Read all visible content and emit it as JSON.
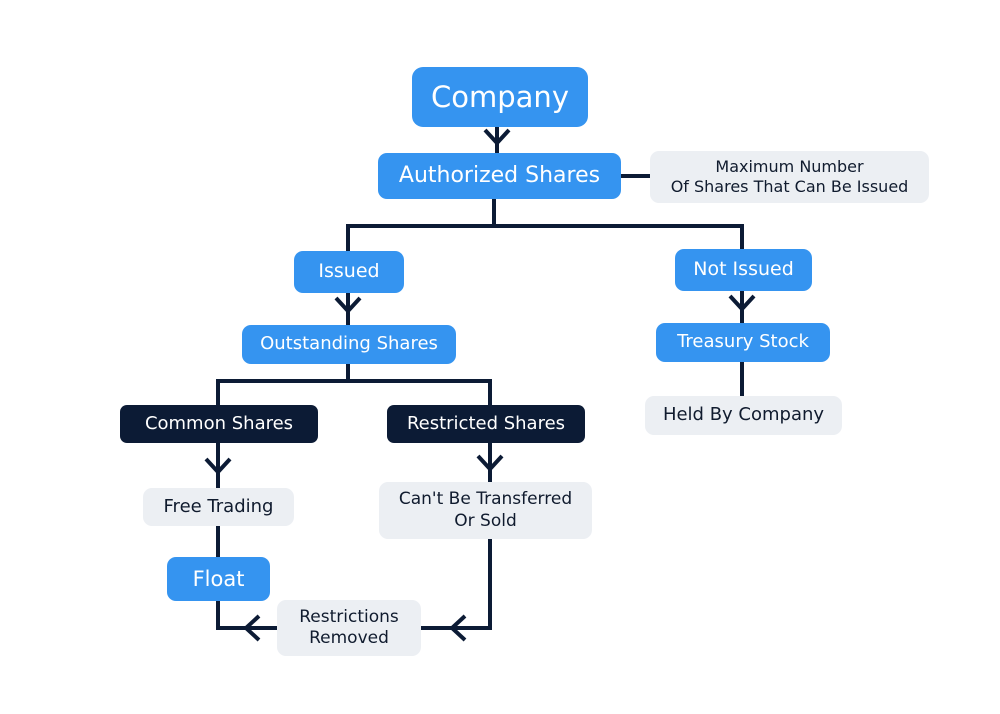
{
  "diagram": {
    "colors": {
      "primary": "#3594f0",
      "dark": "#0c1b35",
      "note": "#eceff3",
      "connector": "#0c1b35"
    },
    "nodes": {
      "company": "Company",
      "authorized_shares": "Authorized Shares",
      "authorized_note": [
        "Maximum Number",
        "Of Shares That Can Be Issued"
      ],
      "issued": "Issued",
      "not_issued": "Not Issued",
      "outstanding_shares": "Outstanding Shares",
      "treasury_stock": "Treasury Stock",
      "held_by_company": "Held By Company",
      "common_shares": "Common Shares",
      "restricted_shares": "Restricted Shares",
      "free_trading": "Free Trading",
      "cant_be_transferred": [
        "Can't Be Transferred",
        "Or Sold"
      ],
      "float": "Float",
      "restrictions_removed": [
        "Restrictions",
        "Removed"
      ]
    },
    "edges": [
      {
        "from": "company",
        "to": "authorized_shares",
        "arrow": true
      },
      {
        "from": "authorized_shares",
        "to": "authorized_note",
        "arrow": false
      },
      {
        "from": "authorized_shares",
        "to": "issued",
        "arrow": false
      },
      {
        "from": "authorized_shares",
        "to": "not_issued",
        "arrow": false
      },
      {
        "from": "issued",
        "to": "outstanding_shares",
        "arrow": true
      },
      {
        "from": "not_issued",
        "to": "treasury_stock",
        "arrow": true
      },
      {
        "from": "treasury_stock",
        "to": "held_by_company",
        "arrow": false
      },
      {
        "from": "outstanding_shares",
        "to": "common_shares",
        "arrow": false
      },
      {
        "from": "outstanding_shares",
        "to": "restricted_shares",
        "arrow": false
      },
      {
        "from": "common_shares",
        "to": "free_trading",
        "arrow": true
      },
      {
        "from": "restricted_shares",
        "to": "cant_be_transferred",
        "arrow": true
      },
      {
        "from": "free_trading",
        "to": "float",
        "arrow": false
      },
      {
        "from": "cant_be_transferred",
        "to": "restrictions_removed",
        "arrow": true
      },
      {
        "from": "restrictions_removed",
        "to": "float",
        "arrow": true
      }
    ]
  }
}
